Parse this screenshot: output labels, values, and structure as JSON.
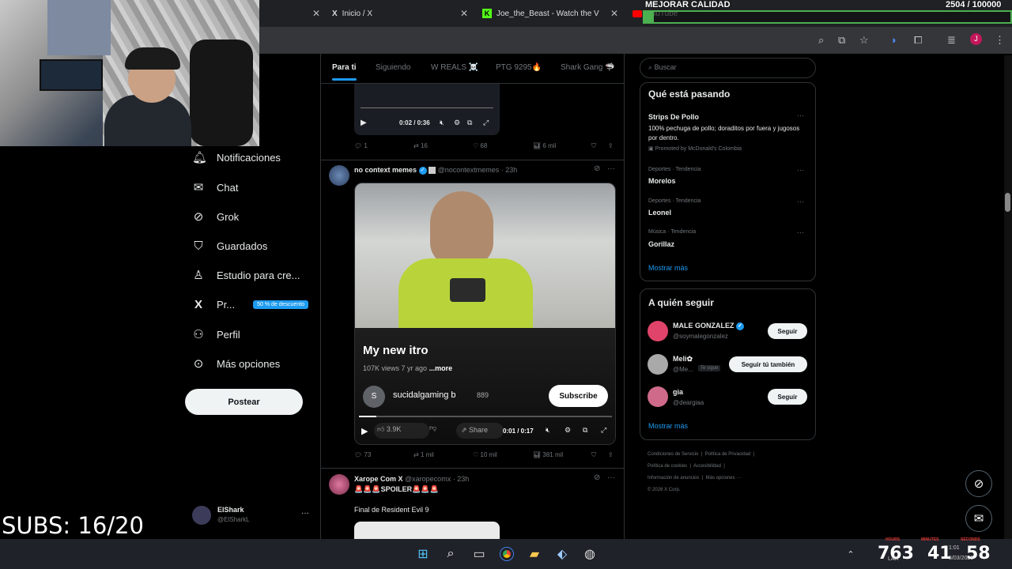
{
  "browser": {
    "tabs": [
      {
        "title": "Inicio / X"
      },
      {
        "title": "Joe_the_Beast - Watch the VOD"
      },
      {
        "title": "YouTube"
      }
    ]
  },
  "subs_counter": "SUBS: 16/20",
  "goal": {
    "label": "MEJORAR CALIDAD",
    "count": "2504 / 100000",
    "progress": 0.025,
    "color": "#4caf50"
  },
  "nav": {
    "items": [
      {
        "label": "Notificaciones",
        "icon": "bell-icon"
      },
      {
        "label": "Chat",
        "icon": "mail-icon"
      },
      {
        "label": "Grok",
        "icon": "grok-icon"
      },
      {
        "label": "Guardados",
        "icon": "bookmark-icon"
      },
      {
        "label": "Estudio para cre...",
        "icon": "studio-icon"
      },
      {
        "label": "Pr...",
        "icon": "x-logo-icon"
      },
      {
        "label": "Perfil",
        "icon": "person-icon"
      },
      {
        "label": "Más opciones",
        "icon": "more-circle-icon"
      }
    ],
    "promo_badge": "50 % de descuento",
    "post_label": "Postear",
    "profile": {
      "name": "ElShark",
      "handle": "@ElSharkL"
    }
  },
  "feed": {
    "tabs": [
      "Para ti",
      "Siguiendo",
      "W REALS ☠️",
      "PTG 9295🔥",
      "Shark Gang 🦈"
    ],
    "top_video": {
      "time": "0:02 / 0:36"
    },
    "top_actions": {
      "replies": "1",
      "reposts": "16",
      "likes": "68",
      "views": "6 mil"
    },
    "tweet1": {
      "author": "no context memes",
      "handle": "@nocontextmemes",
      "time": "23h",
      "video": {
        "title": "My new itro",
        "meta": "107K views  7 yr ago",
        "more": "...more",
        "channel": "sucidalgaming b",
        "channel_initial": "S",
        "channel_subs": "889",
        "subscribe": "Subscribe",
        "likes": "3.9K",
        "share": "Share",
        "time": "0:01 / 0:17"
      },
      "actions": {
        "replies": "73",
        "reposts": "1 mil",
        "likes": "10 mil",
        "views": "381 mil"
      }
    },
    "tweet2": {
      "author": "Xarope Com X",
      "handle": "@xaropecomx",
      "time": "23h",
      "line1": "🚨🚨🚨SPOILER🚨🚨🚨",
      "line2": "Final de Resident Evil 9"
    }
  },
  "sidebar": {
    "search_placeholder": "Buscar",
    "trends_title": "Qué está pasando",
    "promo": {
      "name": "Strips De Pollo",
      "text": "100% pechuga de pollo; doraditos por fuera y jugosos por dentro.",
      "promoted": "Promoted by McDonald's Colombia"
    },
    "trends": [
      {
        "category": "Deportes · Tendencia",
        "name": "Morelos"
      },
      {
        "category": "Deportes · Tendencia",
        "name": "Leonel"
      },
      {
        "category": "Música · Tendencia",
        "name": "Gorillaz"
      }
    ],
    "show_more": "Mostrar más",
    "wtf_title": "A quién seguir",
    "who_to_follow": [
      {
        "name": "MALE GONZALEZ",
        "handle": "@soymalegonzalez",
        "button": "Seguir",
        "badge": ""
      },
      {
        "name": "Meli✿",
        "handle": "@Me...",
        "button": "Seguir tú también",
        "badge": "Te sigue"
      },
      {
        "name": "gia",
        "handle": "@deargiaa",
        "button": "Seguir",
        "badge": ""
      }
    ],
    "footer": [
      "Condiciones de Servicio",
      "Política de Privacidad",
      "Política de cookies",
      "Accesibilidad",
      "Información de anuncios",
      "Más opciones ···",
      "© 2026 X Corp."
    ]
  },
  "overlay_clock": {
    "hours_label": "HOURS",
    "minutes_label": "MINUTES",
    "seconds_label": "SECONDS",
    "hours": "763",
    "minutes": "41",
    "seconds": "58"
  },
  "taskbar": {
    "time": "1:01",
    "date": "5/03/2026",
    "lang": "LAA"
  }
}
